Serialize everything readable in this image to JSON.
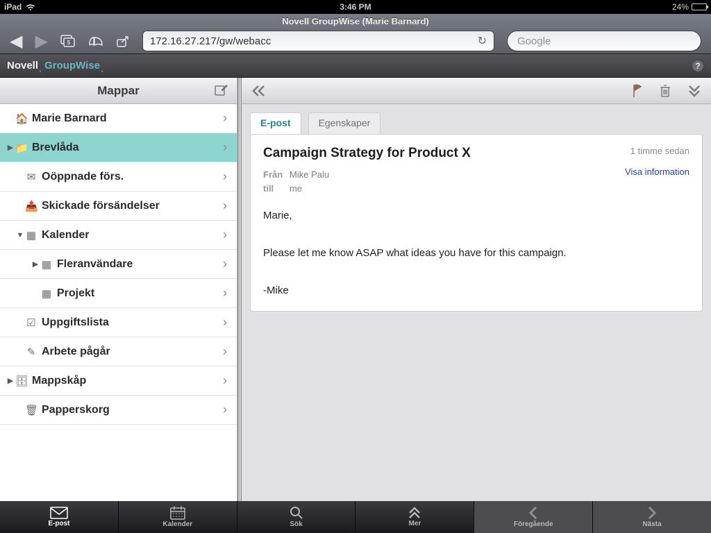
{
  "status": {
    "device": "iPad",
    "time": "3:46 PM",
    "battery_pct": "24%"
  },
  "safari": {
    "title": "Novell GroupWise (Marie Barnard)",
    "url": "172.16.27.217/gw/webacc",
    "search_placeholder": "Google"
  },
  "brand": {
    "novell": "Novell",
    "groupwise": "GroupWise"
  },
  "sidebar": {
    "title": "Mappar",
    "items": [
      {
        "label": "Marie Barnard",
        "icon": "🏠",
        "indent": 0,
        "disclosure": ""
      },
      {
        "label": "Brevlåda",
        "icon": "📁",
        "indent": 0,
        "disclosure": "▶",
        "selected": true
      },
      {
        "label": "Oöppnade förs.",
        "icon": "✉",
        "indent": 1,
        "disclosure": ""
      },
      {
        "label": "Skickade försändelser",
        "icon": "📤",
        "indent": 1,
        "disclosure": ""
      },
      {
        "label": "Kalender",
        "icon": "▦",
        "indent": 1,
        "disclosure": "▼"
      },
      {
        "label": "Fleranvändare",
        "icon": "▦",
        "indent": 2,
        "disclosure": "▶"
      },
      {
        "label": "Projekt",
        "icon": "▦",
        "indent": 2,
        "disclosure": ""
      },
      {
        "label": "Uppgiftslista",
        "icon": "☑",
        "indent": 1,
        "disclosure": ""
      },
      {
        "label": "Arbete pågår",
        "icon": "✎",
        "indent": 1,
        "disclosure": ""
      },
      {
        "label": "Mappskåp",
        "icon": "🗄",
        "indent": 0,
        "disclosure": "▶"
      },
      {
        "label": "Papperskorg",
        "icon": "🗑",
        "indent": 1,
        "disclosure": ""
      }
    ]
  },
  "tabs": {
    "email": "E-post",
    "properties": "Egenskaper"
  },
  "message": {
    "subject": "Campaign Strategy for Product X",
    "time": "1 timme sedan",
    "from_label": "Från",
    "from_value": "Mike Palu",
    "to_label": "till",
    "to_value": "me",
    "show_info": "Visa information",
    "body_line1": "Marie,",
    "body_line2": "Please let me know ASAP what ideas you have for this campaign.",
    "body_line3": "-Mike"
  },
  "tabbar": {
    "email": "E-post",
    "calendar": "Kalender",
    "search": "Sök",
    "more": "Mer",
    "prev": "Föregående",
    "next": "Nästa"
  }
}
